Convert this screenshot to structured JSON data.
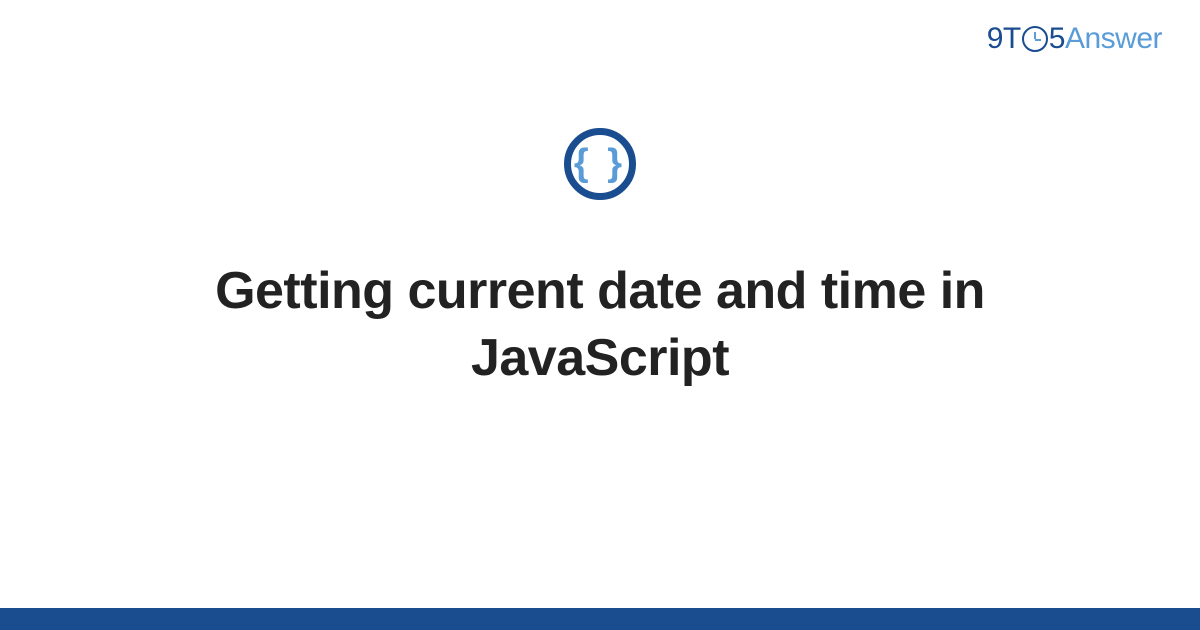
{
  "logo": {
    "part1": "9T",
    "part2": "5",
    "part3": "Answer"
  },
  "icon": {
    "braces": "{ }"
  },
  "title": "Getting current date and time in JavaScript",
  "colors": {
    "brand_dark": "#1a4d8f",
    "brand_light": "#5a9cd8",
    "text": "#222222"
  }
}
